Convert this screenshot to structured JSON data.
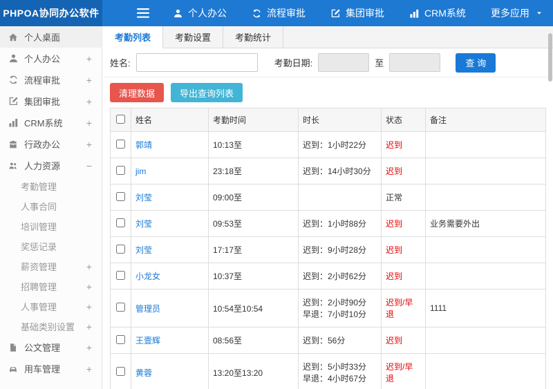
{
  "colors": {
    "header_bg": "#1e79d2",
    "logo_bg": "#1563b3",
    "accent": "#1a79d6",
    "danger": "#e8554d",
    "export": "#42b5d6",
    "status_red": "#e60000"
  },
  "header": {
    "logo": "PHPOA协同办公软件",
    "nav": [
      {
        "name": "personal-office",
        "label": "个人办公",
        "icon": "user-icon",
        "chevron": false
      },
      {
        "name": "workflow-approval",
        "label": "流程审批",
        "icon": "flow-icon",
        "chevron": false
      },
      {
        "name": "group-approval",
        "label": "集团审批",
        "icon": "edit-icon",
        "chevron": false
      },
      {
        "name": "crm-system",
        "label": "CRM系统",
        "icon": "chart-icon",
        "chevron": false
      },
      {
        "name": "more-apps",
        "label": "更多应用",
        "icon": "",
        "chevron": true
      }
    ]
  },
  "sidebar": {
    "items": [
      {
        "name": "personal-desktop",
        "label": "个人桌面",
        "icon": "home-icon",
        "suffix": "",
        "sub": false,
        "active": true
      },
      {
        "name": "personal-office",
        "label": "个人办公",
        "icon": "user-icon",
        "suffix": "+",
        "sub": false,
        "active": false
      },
      {
        "name": "workflow-approval",
        "label": "流程审批",
        "icon": "flow-icon",
        "suffix": "+",
        "sub": false,
        "active": false
      },
      {
        "name": "group-approval",
        "label": "集团审批",
        "icon": "edit-icon",
        "suffix": "+",
        "sub": false,
        "active": false
      },
      {
        "name": "crm-system",
        "label": "CRM系统",
        "icon": "chart-icon",
        "suffix": "+",
        "sub": false,
        "active": false
      },
      {
        "name": "admin-office",
        "label": "行政办公",
        "icon": "briefcase-icon",
        "suffix": "+",
        "sub": false,
        "active": false
      },
      {
        "name": "human-resources",
        "label": "人力资源",
        "icon": "people-icon",
        "suffix": "−",
        "sub": false,
        "active": false
      },
      {
        "name": "attendance-management",
        "label": "考勤管理",
        "icon": "",
        "suffix": "",
        "sub": true,
        "active": false
      },
      {
        "name": "personnel-contract",
        "label": "人事合同",
        "icon": "",
        "suffix": "",
        "sub": true,
        "active": false
      },
      {
        "name": "training-management",
        "label": "培训管理",
        "icon": "",
        "suffix": "",
        "sub": true,
        "active": false
      },
      {
        "name": "reward-punishment",
        "label": "奖惩记录",
        "icon": "",
        "suffix": "",
        "sub": true,
        "active": false
      },
      {
        "name": "salary-management",
        "label": "薪资管理",
        "icon": "",
        "suffix": "+",
        "sub": true,
        "active": false
      },
      {
        "name": "recruitment-management",
        "label": "招聘管理",
        "icon": "",
        "suffix": "+",
        "sub": true,
        "active": false
      },
      {
        "name": "personnel-management",
        "label": "人事管理",
        "icon": "",
        "suffix": "+",
        "sub": true,
        "active": false
      },
      {
        "name": "base-category-settings",
        "label": "基础类别设置",
        "icon": "",
        "suffix": "+",
        "sub": true,
        "active": false
      },
      {
        "name": "document-management",
        "label": "公文管理",
        "icon": "doc-icon",
        "suffix": "+",
        "sub": false,
        "active": false
      },
      {
        "name": "vehicle-management",
        "label": "用车管理",
        "icon": "car-icon",
        "suffix": "+",
        "sub": false,
        "active": false
      }
    ]
  },
  "tabs": [
    {
      "name": "attendance-list",
      "label": "考勤列表",
      "active": true
    },
    {
      "name": "attendance-settings",
      "label": "考勤设置",
      "active": false
    },
    {
      "name": "attendance-stats",
      "label": "考勤统计",
      "active": false
    }
  ],
  "filter": {
    "name_label": "姓名:",
    "name_value": "",
    "date_label": "考勤日期:",
    "date_from_value": "",
    "to_label": "至",
    "date_to_value": "",
    "search_button": "查 询"
  },
  "actions": {
    "clear_button": "清理数据",
    "export_button": "导出查询列表"
  },
  "table": {
    "headers": [
      "姓名",
      "考勤时间",
      "时长",
      "状态",
      "备注"
    ],
    "rows": [
      {
        "name": "郭靖",
        "time": "10:13至",
        "duration_lines": [
          "迟到：1小时22分"
        ],
        "status": "迟到",
        "status_red": true,
        "note": ""
      },
      {
        "name": "jim",
        "time": "23:18至",
        "duration_lines": [
          "迟到：14小时30分"
        ],
        "status": "迟到",
        "status_red": true,
        "note": ""
      },
      {
        "name": "刘莹",
        "time": "09:00至",
        "duration_lines": [],
        "status": "正常",
        "status_red": false,
        "note": ""
      },
      {
        "name": "刘莹",
        "time": "09:53至",
        "duration_lines": [
          "迟到：1小时88分"
        ],
        "status": "迟到",
        "status_red": true,
        "note": "业务需要外出"
      },
      {
        "name": "刘莹",
        "time": "17:17至",
        "duration_lines": [
          "迟到：9小时28分"
        ],
        "status": "迟到",
        "status_red": true,
        "note": ""
      },
      {
        "name": "小龙女",
        "time": "10:37至",
        "duration_lines": [
          "迟到：2小时62分"
        ],
        "status": "迟到",
        "status_red": true,
        "note": ""
      },
      {
        "name": "管理员",
        "time": "10:54至10:54",
        "duration_lines": [
          "迟到：2小时90分",
          "早退：7小时10分"
        ],
        "status": "迟到/早退",
        "status_red": true,
        "note": "1111"
      },
      {
        "name": "王壹辉",
        "time": "08:56至",
        "duration_lines": [
          "迟到：56分"
        ],
        "status": "迟到",
        "status_red": true,
        "note": ""
      },
      {
        "name": "黄蓉",
        "time": "13:20至13:20",
        "duration_lines": [
          "迟到：5小时33分",
          "早退：4小时67分"
        ],
        "status": "迟到/早退",
        "status_red": true,
        "note": ""
      }
    ]
  }
}
